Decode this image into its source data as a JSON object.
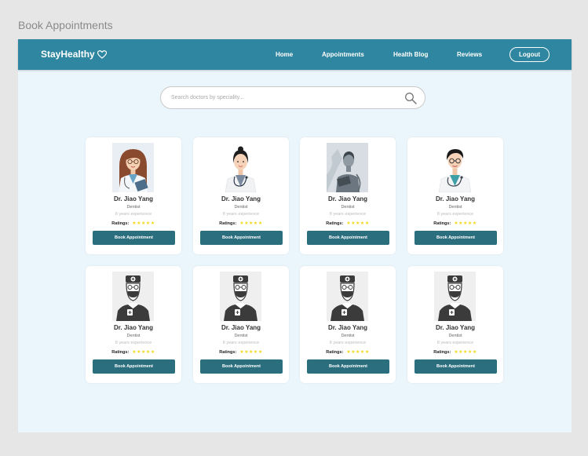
{
  "frame_title": "Book Appointments",
  "navbar": {
    "brand": "StayHealthy",
    "links": [
      "Home",
      "Appointments",
      "Health Blog",
      "Reviews"
    ],
    "logout": "Logout"
  },
  "search": {
    "placeholder": "Search doctors by speciality..."
  },
  "colors": {
    "navbar": "#2f86a0",
    "button": "#2b6e7d",
    "background": "#eaf6fc",
    "star": "#f0d81c"
  },
  "doctors": [
    {
      "name": "Dr. Jiao Yang",
      "specialty": "Dentist",
      "experience": "8 years experience",
      "ratings_label": "Ratings:",
      "stars": "★★★★★",
      "rating": 5,
      "button": "Book Appointment",
      "photo": "female-doctor-glasses"
    },
    {
      "name": "Dr. Jiao Yang",
      "specialty": "Dentist",
      "experience": "8 years experience",
      "ratings_label": "Ratings:",
      "stars": "★★★★★",
      "rating": 5,
      "button": "Book Appointment",
      "photo": "female-doctor-stethoscope"
    },
    {
      "name": "Dr. Jiao Yang",
      "specialty": "Dentist",
      "experience": "8 years experience",
      "ratings_label": "Ratings:",
      "stars": "★★★★★",
      "rating": 5,
      "button": "Book Appointment",
      "photo": "doctor-grey-portrait"
    },
    {
      "name": "Dr. Jiao Yang",
      "specialty": "Dentist",
      "experience": "8 years experience",
      "ratings_label": "Ratings:",
      "stars": "★★★★★",
      "rating": 5,
      "button": "Book Appointment",
      "photo": "male-doctor-glasses"
    },
    {
      "name": "Dr. Jiao Yang",
      "specialty": "Dentist",
      "experience": "8 years experience",
      "ratings_label": "Ratings:",
      "stars": "★★★★★",
      "rating": 5,
      "button": "Book Appointment",
      "photo": "doctor-placeholder-icon"
    },
    {
      "name": "Dr. Jiao Yang",
      "specialty": "Dentist",
      "experience": "8 years experience",
      "ratings_label": "Ratings:",
      "stars": "★★★★★",
      "rating": 5,
      "button": "Book Appointment",
      "photo": "doctor-placeholder-icon"
    },
    {
      "name": "Dr. Jiao Yang",
      "specialty": "Dentist",
      "experience": "8 years experience",
      "ratings_label": "Ratings:",
      "stars": "★★★★★",
      "rating": 5,
      "button": "Book Appointment",
      "photo": "doctor-placeholder-icon"
    },
    {
      "name": "Dr. Jiao Yang",
      "specialty": "Dentist",
      "experience": "8 years experience",
      "ratings_label": "Ratings:",
      "stars": "★★★★★",
      "rating": 5,
      "button": "Book Appointment",
      "photo": "doctor-placeholder-icon"
    }
  ]
}
